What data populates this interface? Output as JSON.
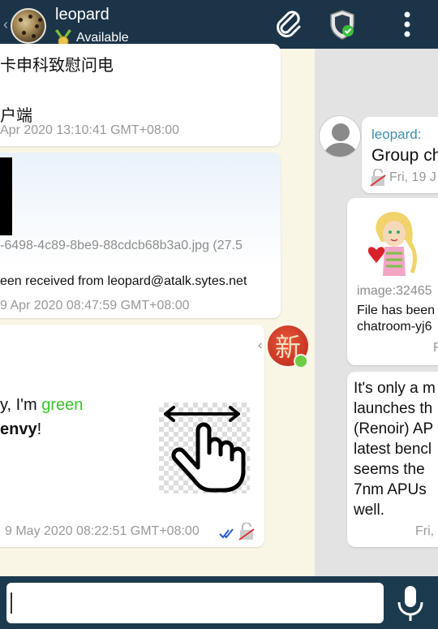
{
  "header": {
    "contact_name": "leopard",
    "status": "Available",
    "icons": [
      "back-chevron-icon",
      "avatar",
      "medal-icon",
      "attach-icon",
      "security-shield-icon",
      "overflow-menu-icon"
    ]
  },
  "left_chat": {
    "msg1": {
      "line1": "卡申科致慰问电",
      "line2": "户端",
      "time": "Apr 2020 13:10:41 GMT+08:00"
    },
    "msg2": {
      "filename": "-6498-4c89-8be9-88cdcb68b3a0.jpg (27.5",
      "note": "een received from leopard@atalk.sytes.net",
      "time": "9 Apr 2020 08:47:59 GMT+08:00"
    },
    "msg3": {
      "pre": "y, I'm ",
      "green_word": "green",
      "envy": "envy",
      "excl": "!",
      "time": "9 May 2020 08:22:51 GMT+08:00"
    }
  },
  "right_chat": {
    "msg1": {
      "sender": "leopard:",
      "text": "Group ch",
      "time": "Fri, 19 J"
    },
    "msg2": {
      "file": "image:32465",
      "note1": "File has been",
      "note2": "chatroom-yj6",
      "time": "F"
    },
    "msg3": {
      "lines": [
        "It's only a m",
        "launches th",
        "(Renoir) AP",
        "latest bencl",
        "seems the",
        "7nm APUs",
        "well."
      ],
      "time": "Fri, 1"
    }
  },
  "composer": {
    "placeholder": ""
  },
  "colors": {
    "topbar": "#1b3448",
    "left_bg": "#faf6e6",
    "right_bg": "#e3e3e3",
    "sender": "#3f8fb3",
    "green": "#39c32c"
  }
}
